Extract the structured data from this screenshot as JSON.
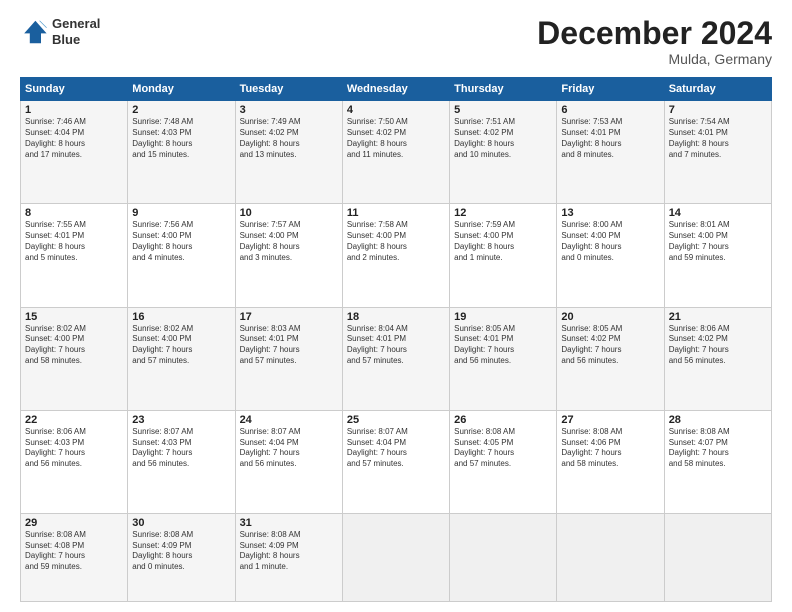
{
  "header": {
    "logo_line1": "General",
    "logo_line2": "Blue",
    "month": "December 2024",
    "location": "Mulda, Germany"
  },
  "weekdays": [
    "Sunday",
    "Monday",
    "Tuesday",
    "Wednesday",
    "Thursday",
    "Friday",
    "Saturday"
  ],
  "weeks": [
    [
      {
        "day": "1",
        "lines": [
          "Sunrise: 7:46 AM",
          "Sunset: 4:04 PM",
          "Daylight: 8 hours",
          "and 17 minutes."
        ]
      },
      {
        "day": "2",
        "lines": [
          "Sunrise: 7:48 AM",
          "Sunset: 4:03 PM",
          "Daylight: 8 hours",
          "and 15 minutes."
        ]
      },
      {
        "day": "3",
        "lines": [
          "Sunrise: 7:49 AM",
          "Sunset: 4:02 PM",
          "Daylight: 8 hours",
          "and 13 minutes."
        ]
      },
      {
        "day": "4",
        "lines": [
          "Sunrise: 7:50 AM",
          "Sunset: 4:02 PM",
          "Daylight: 8 hours",
          "and 11 minutes."
        ]
      },
      {
        "day": "5",
        "lines": [
          "Sunrise: 7:51 AM",
          "Sunset: 4:02 PM",
          "Daylight: 8 hours",
          "and 10 minutes."
        ]
      },
      {
        "day": "6",
        "lines": [
          "Sunrise: 7:53 AM",
          "Sunset: 4:01 PM",
          "Daylight: 8 hours",
          "and 8 minutes."
        ]
      },
      {
        "day": "7",
        "lines": [
          "Sunrise: 7:54 AM",
          "Sunset: 4:01 PM",
          "Daylight: 8 hours",
          "and 7 minutes."
        ]
      }
    ],
    [
      {
        "day": "8",
        "lines": [
          "Sunrise: 7:55 AM",
          "Sunset: 4:01 PM",
          "Daylight: 8 hours",
          "and 5 minutes."
        ]
      },
      {
        "day": "9",
        "lines": [
          "Sunrise: 7:56 AM",
          "Sunset: 4:00 PM",
          "Daylight: 8 hours",
          "and 4 minutes."
        ]
      },
      {
        "day": "10",
        "lines": [
          "Sunrise: 7:57 AM",
          "Sunset: 4:00 PM",
          "Daylight: 8 hours",
          "and 3 minutes."
        ]
      },
      {
        "day": "11",
        "lines": [
          "Sunrise: 7:58 AM",
          "Sunset: 4:00 PM",
          "Daylight: 8 hours",
          "and 2 minutes."
        ]
      },
      {
        "day": "12",
        "lines": [
          "Sunrise: 7:59 AM",
          "Sunset: 4:00 PM",
          "Daylight: 8 hours",
          "and 1 minute."
        ]
      },
      {
        "day": "13",
        "lines": [
          "Sunrise: 8:00 AM",
          "Sunset: 4:00 PM",
          "Daylight: 8 hours",
          "and 0 minutes."
        ]
      },
      {
        "day": "14",
        "lines": [
          "Sunrise: 8:01 AM",
          "Sunset: 4:00 PM",
          "Daylight: 7 hours",
          "and 59 minutes."
        ]
      }
    ],
    [
      {
        "day": "15",
        "lines": [
          "Sunrise: 8:02 AM",
          "Sunset: 4:00 PM",
          "Daylight: 7 hours",
          "and 58 minutes."
        ]
      },
      {
        "day": "16",
        "lines": [
          "Sunrise: 8:02 AM",
          "Sunset: 4:00 PM",
          "Daylight: 7 hours",
          "and 57 minutes."
        ]
      },
      {
        "day": "17",
        "lines": [
          "Sunrise: 8:03 AM",
          "Sunset: 4:01 PM",
          "Daylight: 7 hours",
          "and 57 minutes."
        ]
      },
      {
        "day": "18",
        "lines": [
          "Sunrise: 8:04 AM",
          "Sunset: 4:01 PM",
          "Daylight: 7 hours",
          "and 57 minutes."
        ]
      },
      {
        "day": "19",
        "lines": [
          "Sunrise: 8:05 AM",
          "Sunset: 4:01 PM",
          "Daylight: 7 hours",
          "and 56 minutes."
        ]
      },
      {
        "day": "20",
        "lines": [
          "Sunrise: 8:05 AM",
          "Sunset: 4:02 PM",
          "Daylight: 7 hours",
          "and 56 minutes."
        ]
      },
      {
        "day": "21",
        "lines": [
          "Sunrise: 8:06 AM",
          "Sunset: 4:02 PM",
          "Daylight: 7 hours",
          "and 56 minutes."
        ]
      }
    ],
    [
      {
        "day": "22",
        "lines": [
          "Sunrise: 8:06 AM",
          "Sunset: 4:03 PM",
          "Daylight: 7 hours",
          "and 56 minutes."
        ]
      },
      {
        "day": "23",
        "lines": [
          "Sunrise: 8:07 AM",
          "Sunset: 4:03 PM",
          "Daylight: 7 hours",
          "and 56 minutes."
        ]
      },
      {
        "day": "24",
        "lines": [
          "Sunrise: 8:07 AM",
          "Sunset: 4:04 PM",
          "Daylight: 7 hours",
          "and 56 minutes."
        ]
      },
      {
        "day": "25",
        "lines": [
          "Sunrise: 8:07 AM",
          "Sunset: 4:04 PM",
          "Daylight: 7 hours",
          "and 57 minutes."
        ]
      },
      {
        "day": "26",
        "lines": [
          "Sunrise: 8:08 AM",
          "Sunset: 4:05 PM",
          "Daylight: 7 hours",
          "and 57 minutes."
        ]
      },
      {
        "day": "27",
        "lines": [
          "Sunrise: 8:08 AM",
          "Sunset: 4:06 PM",
          "Daylight: 7 hours",
          "and 58 minutes."
        ]
      },
      {
        "day": "28",
        "lines": [
          "Sunrise: 8:08 AM",
          "Sunset: 4:07 PM",
          "Daylight: 7 hours",
          "and 58 minutes."
        ]
      }
    ],
    [
      {
        "day": "29",
        "lines": [
          "Sunrise: 8:08 AM",
          "Sunset: 4:08 PM",
          "Daylight: 7 hours",
          "and 59 minutes."
        ]
      },
      {
        "day": "30",
        "lines": [
          "Sunrise: 8:08 AM",
          "Sunset: 4:09 PM",
          "Daylight: 8 hours",
          "and 0 minutes."
        ]
      },
      {
        "day": "31",
        "lines": [
          "Sunrise: 8:08 AM",
          "Sunset: 4:09 PM",
          "Daylight: 8 hours",
          "and 1 minute."
        ]
      },
      null,
      null,
      null,
      null
    ]
  ]
}
